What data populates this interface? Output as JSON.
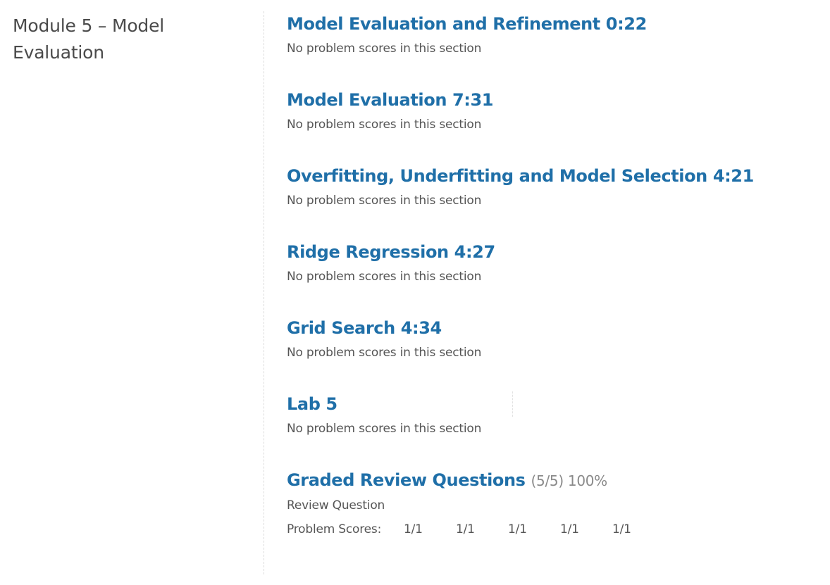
{
  "chapter": {
    "title": "Module 5 – Model Evaluation"
  },
  "sections": [
    {
      "title": "Model Evaluation and Refinement 0:22",
      "status": "No problem scores in this section"
    },
    {
      "title": "Model Evaluation 7:31",
      "status": "No problem scores in this section"
    },
    {
      "title": "Overfitting, Underfitting and Model Selection 4:21",
      "status": "No problem scores in this section"
    },
    {
      "title": "Ridge Regression 4:27",
      "status": "No problem scores in this section"
    },
    {
      "title": "Grid Search 4:34",
      "status": "No problem scores in this section"
    },
    {
      "title": "Lab 5",
      "status": "No problem scores in this section"
    }
  ],
  "graded": {
    "title": "Graded Review Questions",
    "summary": "(5/5) 100%",
    "subsection": "Review Question",
    "scores_label": "Problem Scores:",
    "scores": [
      "1/1",
      "1/1",
      "1/1",
      "1/1",
      "1/1"
    ]
  }
}
